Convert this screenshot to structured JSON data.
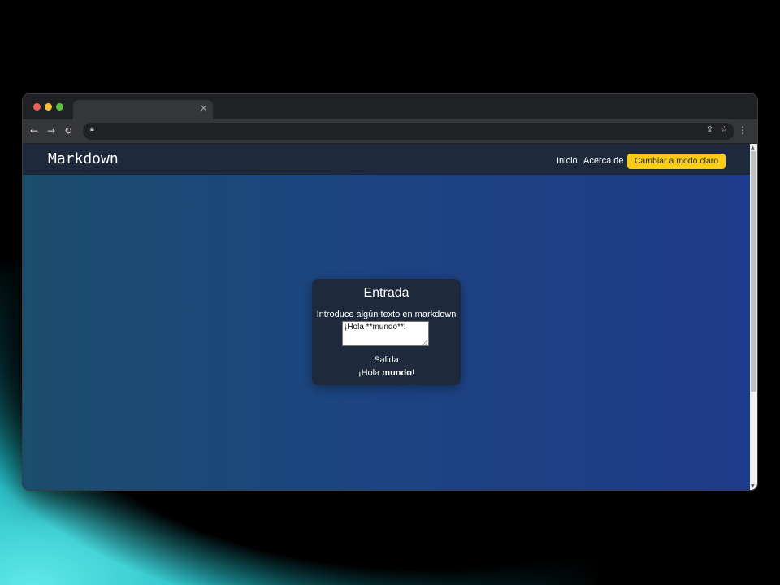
{
  "browser": {
    "tab_close_glyph": "×",
    "icons": {
      "back": "back-arrow-icon",
      "forward": "forward-arrow-icon",
      "reload": "reload-icon",
      "lock": "lock-icon",
      "share": "share-icon",
      "bookmark": "star-icon",
      "menu": "kebab-menu-icon"
    }
  },
  "app": {
    "brand": "Markdown",
    "nav": {
      "home_label": "Inicio",
      "about_label": "Acerca de",
      "theme_button_label": "Cambiar a modo claro"
    },
    "colors": {
      "navbar_bg": "#1e293b",
      "accent_button": "#facc15",
      "gradient_start": "#1b4d6d",
      "gradient_end": "#1e3a8a"
    }
  },
  "card": {
    "title": "Entrada",
    "prompt": "Introduce algún texto en markdown",
    "input_value": "¡Hola **mundo**!",
    "output_label": "Salida",
    "output_text_plain": "¡Hola ",
    "output_text_bold": "mundo",
    "output_text_end": "!"
  }
}
